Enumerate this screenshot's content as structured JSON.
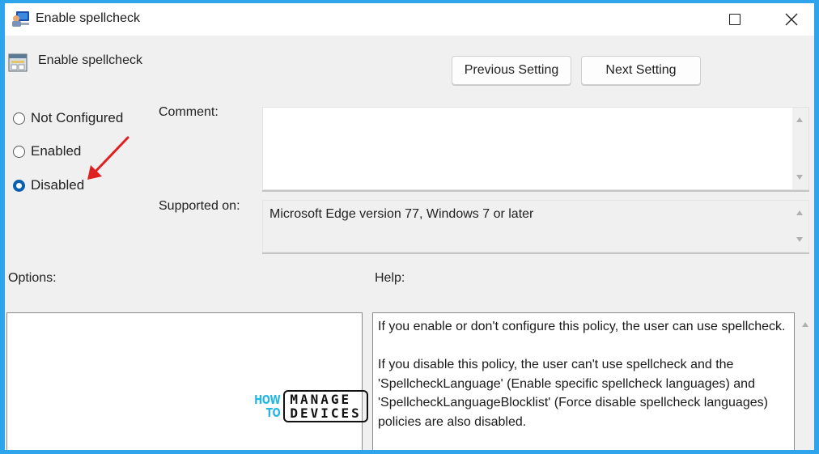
{
  "window": {
    "title": "Enable spellcheck",
    "controls": [
      "maximize",
      "close"
    ]
  },
  "policy": {
    "name": "Enable spellcheck",
    "icon": "policy-setting-icon"
  },
  "navigation": {
    "previous_label": "Previous Setting",
    "next_label": "Next Setting"
  },
  "state": {
    "options": [
      {
        "label": "Not Configured",
        "checked": false
      },
      {
        "label": "Enabled",
        "checked": false
      },
      {
        "label": "Disabled",
        "checked": true
      }
    ],
    "annotation": "red-arrow-pointing-to-disabled"
  },
  "comment": {
    "label": "Comment:",
    "value": ""
  },
  "supported_on": {
    "label": "Supported on:",
    "value": "Microsoft Edge version 77, Windows 7 or later"
  },
  "options_panel": {
    "label": "Options:"
  },
  "help_panel": {
    "label": "Help:",
    "paragraphs": [
      "If you enable or don't configure this policy, the user can use spellcheck.",
      "If you disable this policy, the user can't use spellcheck and the 'SpellcheckLanguage' (Enable specific spellcheck languages) and 'SpellcheckLanguageBlocklist' (Force disable spellcheck languages) policies are also disabled."
    ]
  },
  "watermark": {
    "how_to_line1": "HOW",
    "how_to_line2": "TO",
    "brand_line1": "MANAGE",
    "brand_line2": "DEVICES",
    "accent_color": "#22b6e8"
  },
  "colors": {
    "frame": "#2ea4ec",
    "selected_radio": "#0a5fb0",
    "annotation_arrow": "#e02020"
  }
}
